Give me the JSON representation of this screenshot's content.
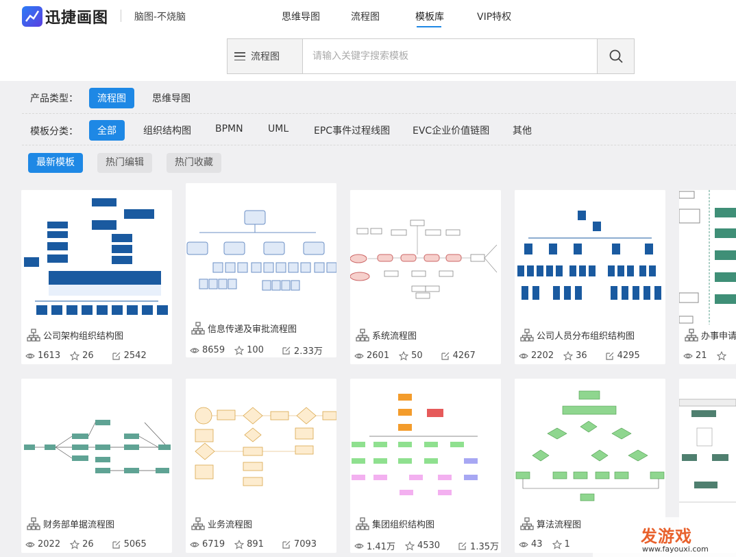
{
  "header": {
    "logo_text": "迅捷画图",
    "subtitle": "脑图-不烧脑",
    "nav": [
      {
        "label": "思维导图",
        "active": false
      },
      {
        "label": "流程图",
        "active": false
      },
      {
        "label": "模板库",
        "active": true
      },
      {
        "label": "VIP特权",
        "active": false
      }
    ]
  },
  "search": {
    "type_label": "流程图",
    "placeholder": "请输入关键字搜索模板"
  },
  "filters": {
    "product_label": "产品类型：",
    "product_options": [
      "流程图",
      "思维导图"
    ],
    "product_selected": "流程图",
    "category_label": "模板分类：",
    "category_options": [
      "全部",
      "组织结构图",
      "BPMN",
      "UML",
      "EPC事件过程线图",
      "EVC企业价值链图",
      "其他"
    ],
    "category_selected": "全部"
  },
  "sort_tabs": [
    "最新模板",
    "热门编辑",
    "热门收藏"
  ],
  "sort_selected": "最新模板",
  "accent_color": "#1e88e5",
  "cards": [
    {
      "title": "公司架构组织结构图",
      "views": "1613",
      "likes": "26",
      "edits": "2542"
    },
    {
      "title": "信息传递及审批流程图",
      "views": "8659",
      "likes": "100",
      "edits": "2.33万"
    },
    {
      "title": "系统流程图",
      "views": "2601",
      "likes": "50",
      "edits": "4267"
    },
    {
      "title": "公司人员分布组织结构图",
      "views": "2202",
      "likes": "36",
      "edits": "4295"
    },
    {
      "title": "办事申请流",
      "views": "21",
      "likes": "",
      "edits": ""
    },
    {
      "title": "财务部单据流程图",
      "views": "2022",
      "likes": "26",
      "edits": "5065"
    },
    {
      "title": "业务流程图",
      "views": "6719",
      "likes": "891",
      "edits": "7093"
    },
    {
      "title": "集团组织结构图",
      "views": "1.41万",
      "likes": "4530",
      "edits": "1.35万"
    },
    {
      "title": "算法流程图",
      "views": "43",
      "likes": "1",
      "edits": ""
    },
    {
      "title": "",
      "views": "",
      "likes": "",
      "edits": ""
    }
  ],
  "watermark": {
    "text": "发游戏",
    "url": "www.fayouxi.com"
  }
}
